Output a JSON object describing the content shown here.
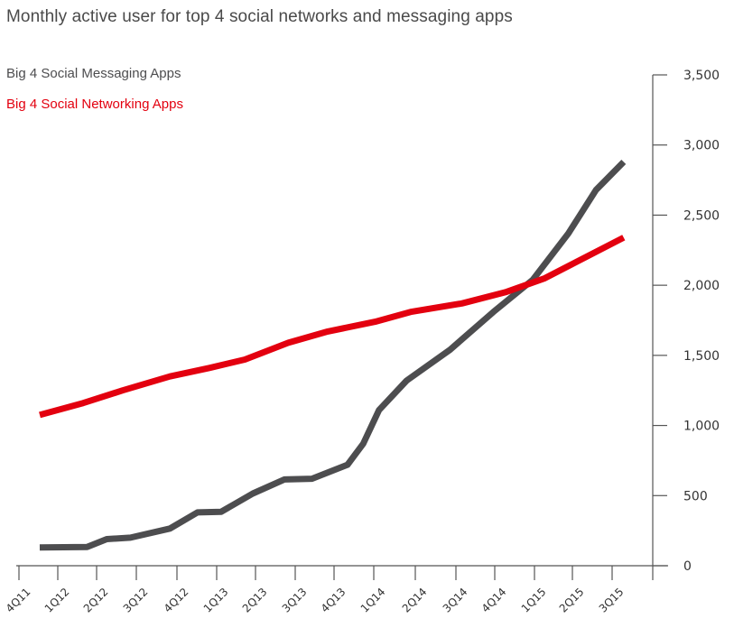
{
  "chart_data": {
    "type": "line",
    "title": "Monthly active user for top 4 social networks and messaging apps",
    "xlabel": "",
    "ylabel": "",
    "categories": [
      "4Q11",
      "1Q12",
      "2Q12",
      "3Q12",
      "4Q12",
      "1Q13",
      "2Q13",
      "3Q13",
      "4Q13",
      "1Q14",
      "2Q14",
      "3Q14",
      "4Q14",
      "1Q15",
      "2Q15",
      "3Q15"
    ],
    "yticks": [
      0,
      500,
      1000,
      1500,
      2000,
      2500,
      3000,
      3500
    ],
    "ytick_labels": [
      "0",
      "500",
      "1,000",
      "1,500",
      "2,000",
      "2,500",
      "3,000",
      "3,500"
    ],
    "ylim": [
      0,
      3500
    ],
    "y_axis_position": "right",
    "grid": false,
    "legend_position": "top-left",
    "series": [
      {
        "name": "Big 4 Social Messaging Apps",
        "color": "#4d4d4f",
        "x": [
          0,
          1.2,
          1.7,
          2.3,
          3.3,
          4.0,
          4.6,
          5.4,
          6.2,
          6.9,
          7.8,
          8.2,
          8.6,
          9.3,
          10.4,
          11.5,
          12.5,
          13.4,
          14.1,
          14.8
        ],
        "values": [
          130,
          133,
          190,
          200,
          265,
          380,
          385,
          515,
          615,
          620,
          720,
          870,
          1110,
          1320,
          1540,
          1810,
          2040,
          2370,
          2680,
          2880
        ]
      },
      {
        "name": "Big 4 Social Networking Apps",
        "color": "#e3000f",
        "x": [
          0,
          1.1,
          2.1,
          3.3,
          4.3,
          5.2,
          6.3,
          7.3,
          8.5,
          9.4,
          10.7,
          11.8,
          12.8,
          14.8
        ],
        "values": [
          1075,
          1160,
          1250,
          1350,
          1410,
          1470,
          1590,
          1670,
          1740,
          1810,
          1870,
          1950,
          2050,
          2340
        ]
      }
    ]
  },
  "legend": {
    "messaging": "Big 4 Social Messaging Apps",
    "networking": "Big 4 Social Networking Apps"
  }
}
